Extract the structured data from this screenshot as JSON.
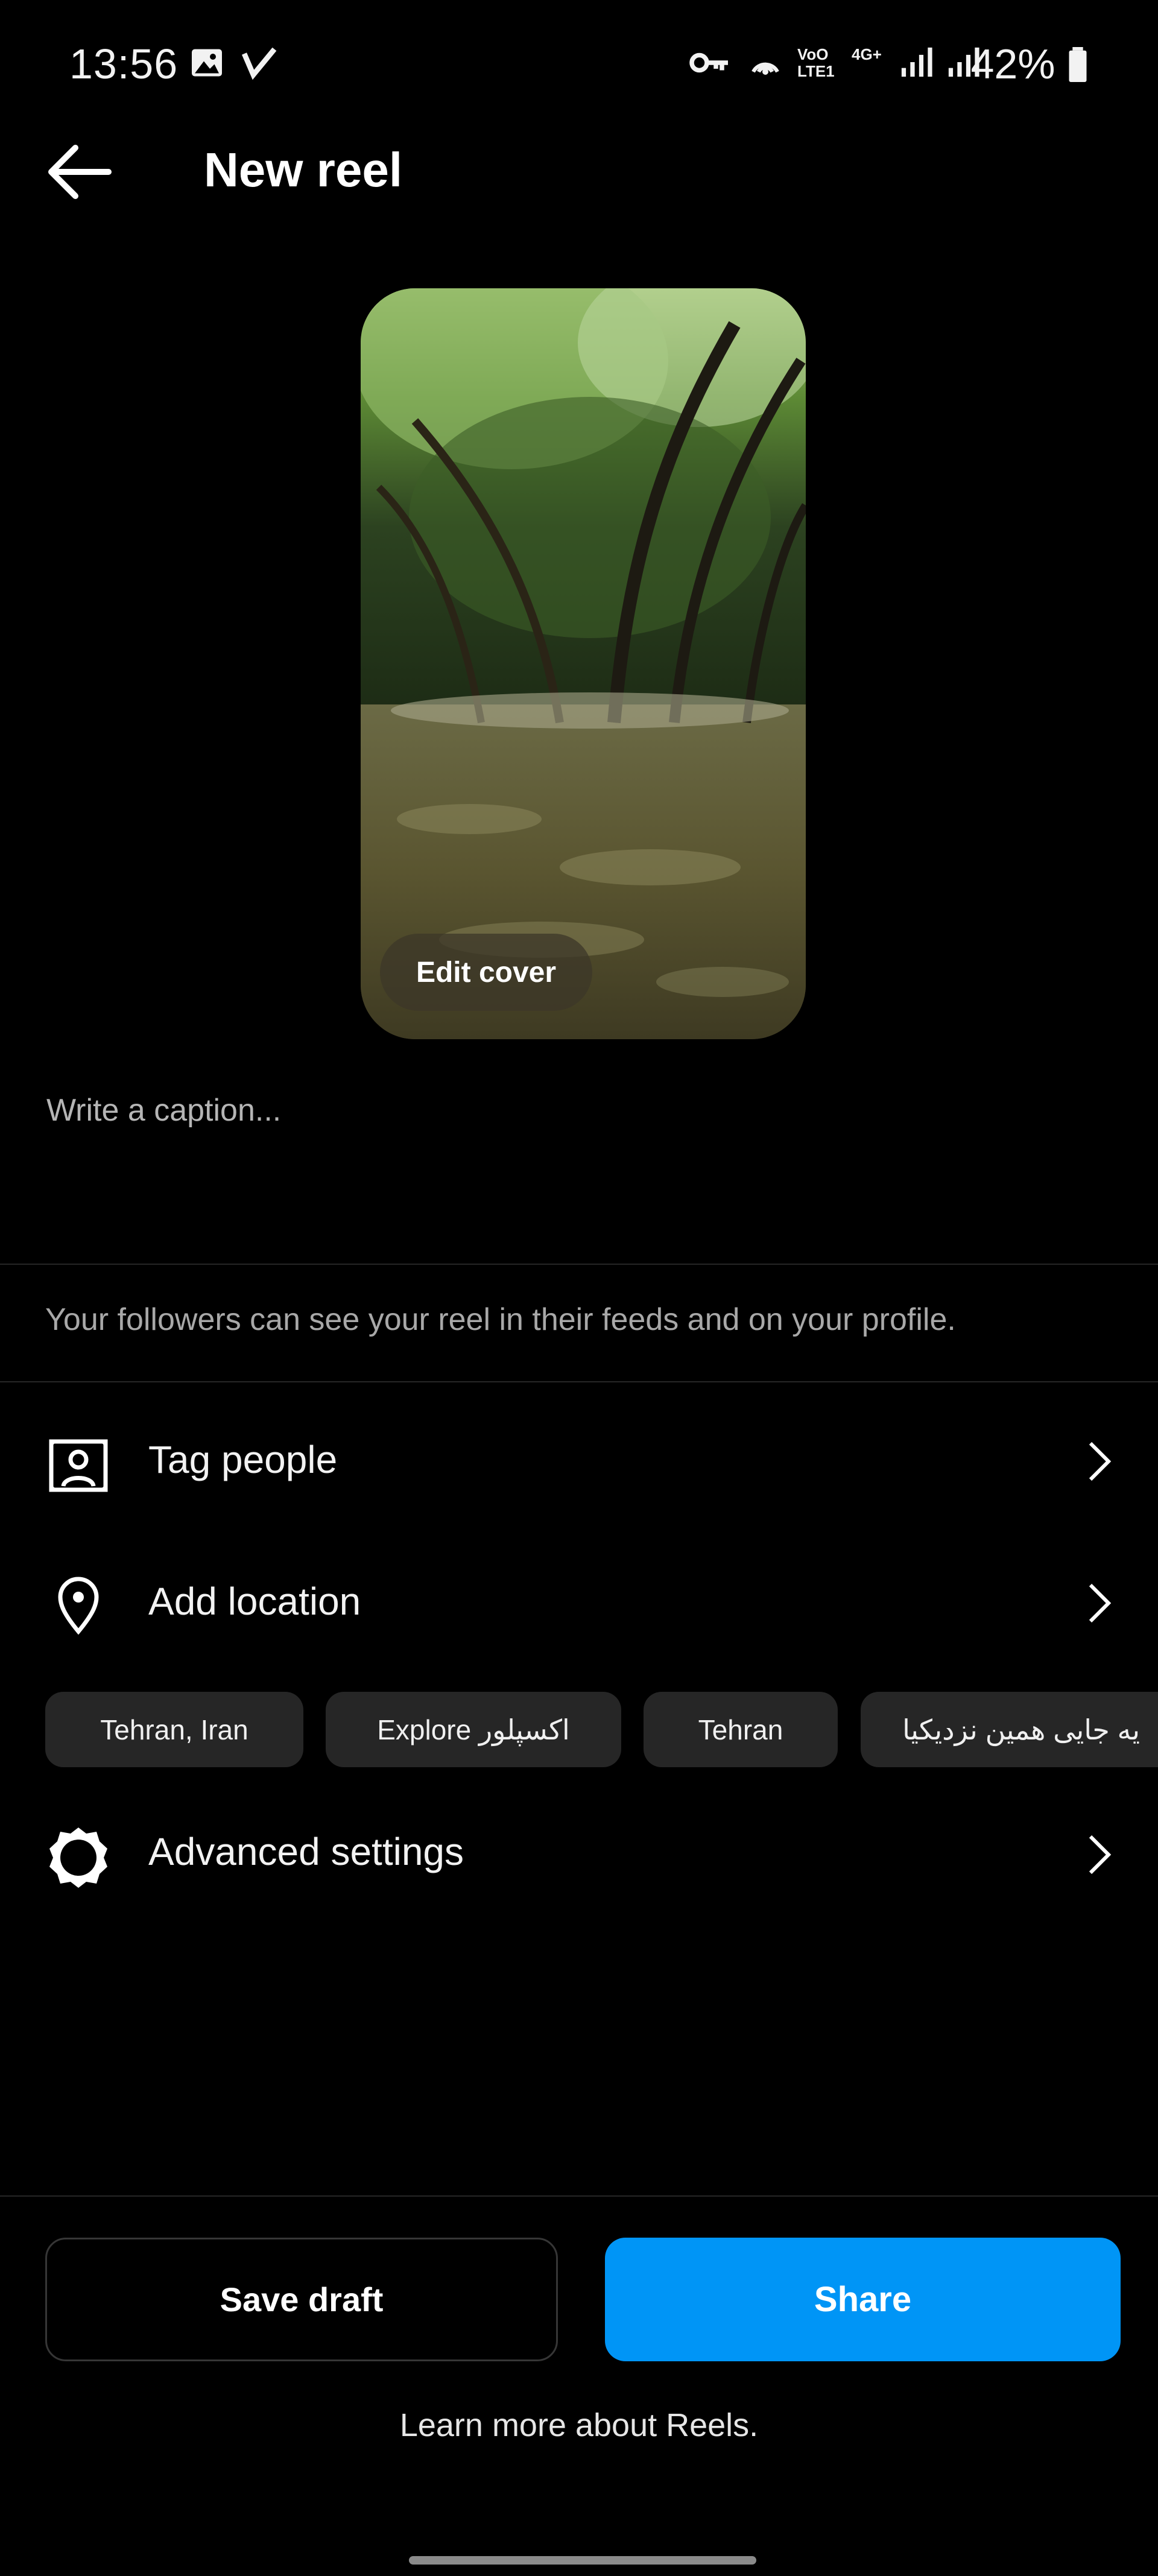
{
  "status_bar": {
    "time": "13:56",
    "network_labels": [
      "VoO LTE1",
      "4G+"
    ],
    "battery": "42%",
    "icons": [
      "gallery-icon",
      "check-icon",
      "key-icon",
      "hotspot-icon",
      "signal-icon",
      "signal-icon",
      "battery-icon"
    ]
  },
  "header": {
    "title": "New reel",
    "back_icon": "arrow-left-icon"
  },
  "cover": {
    "edit_label": "Edit cover"
  },
  "caption": {
    "placeholder": "Write a caption..."
  },
  "followers_note": "Your followers can see your reel in their feeds and on your profile.",
  "options": [
    {
      "label": "Tag people",
      "icon": "tag-person-icon"
    },
    {
      "label": "Add location",
      "icon": "location-pin-icon"
    },
    {
      "label": "Advanced settings",
      "icon": "gear-icon"
    }
  ],
  "location_chips": [
    "Tehran, Iran",
    "Explore اکسپلور",
    "Tehran",
    "یه جایی همین نزدیکیا"
  ],
  "actions": {
    "save_draft": "Save draft",
    "share": "Share"
  },
  "footer": {
    "learn_more": "Learn more about Reels."
  },
  "colors": {
    "background": "#000000",
    "accent": "#0095f6",
    "chip": "#262626",
    "muted_text": "#a8a8a8"
  }
}
